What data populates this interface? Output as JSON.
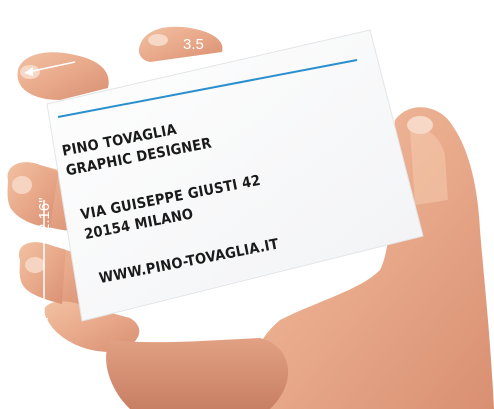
{
  "card": {
    "name": "PINO TOVAGLIA",
    "role": "GRAPHIC DESIGNER",
    "address_line1": "VIA GUISEPPE GIUSTI 42",
    "address_line2": "20154 MILANO",
    "website": "WWW.PINO-TOVAGLIA.IT",
    "accent_color": "#2a8fcf"
  },
  "dimensions": {
    "width_label": "3.5",
    "height_label": "2.16\""
  }
}
